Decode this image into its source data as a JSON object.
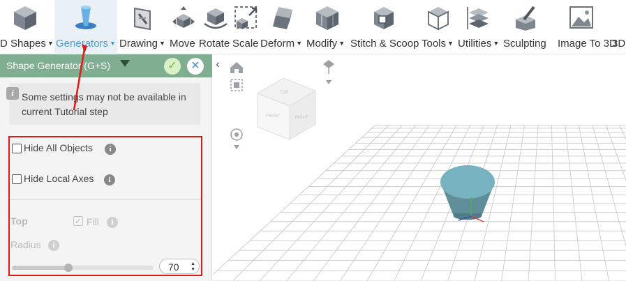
{
  "toolbar": {
    "items": [
      {
        "label": "D Shapes",
        "icon": "cube-icon",
        "caret": true
      },
      {
        "label": "Generators",
        "icon": "generator-icon",
        "caret": true,
        "active": true
      },
      {
        "label": "Drawing",
        "icon": "drawing-icon",
        "caret": true
      },
      {
        "label": "Move",
        "icon": "move-icon",
        "caret": false
      },
      {
        "label": "Rotate",
        "icon": "rotate-icon",
        "caret": false
      },
      {
        "label": "Scale",
        "icon": "scale-icon",
        "caret": false
      },
      {
        "label": "Deform",
        "icon": "deform-icon",
        "caret": true
      },
      {
        "label": "Modify",
        "icon": "modify-icon",
        "caret": true
      },
      {
        "label": "Stitch & Scoop",
        "icon": "stitch-scoop-icon",
        "caret": false
      },
      {
        "label": "Tools",
        "icon": "tools-icon",
        "caret": true
      },
      {
        "label": "Utilities",
        "icon": "utilities-icon",
        "caret": true
      },
      {
        "label": "Sculpting",
        "icon": "sculpting-icon",
        "caret": false
      },
      {
        "label": "Image To 3D",
        "icon": "image-to-3d-icon",
        "caret": false
      },
      {
        "label": "3D",
        "icon": "",
        "caret": false
      }
    ]
  },
  "panel": {
    "title": "Shape Generator (G+S)",
    "ok_icon": "check-icon",
    "close_icon": "close-icon",
    "info_text": "Some settings may not be available in current Tutorial step",
    "hide_all_objects": "Hide All Objects",
    "hide_local_axes": "Hide Local Axes",
    "top_label": "Top",
    "fill_label": "Fill",
    "fill_checked": true,
    "radius_label": "Radius",
    "radius_value": "70",
    "radius_slider_fraction": 0.4
  },
  "colors": {
    "panel_header": "#7fae91",
    "active_tab": "#4e9ad0",
    "highlight": "#e01919",
    "shape": "#6fa6b3"
  }
}
